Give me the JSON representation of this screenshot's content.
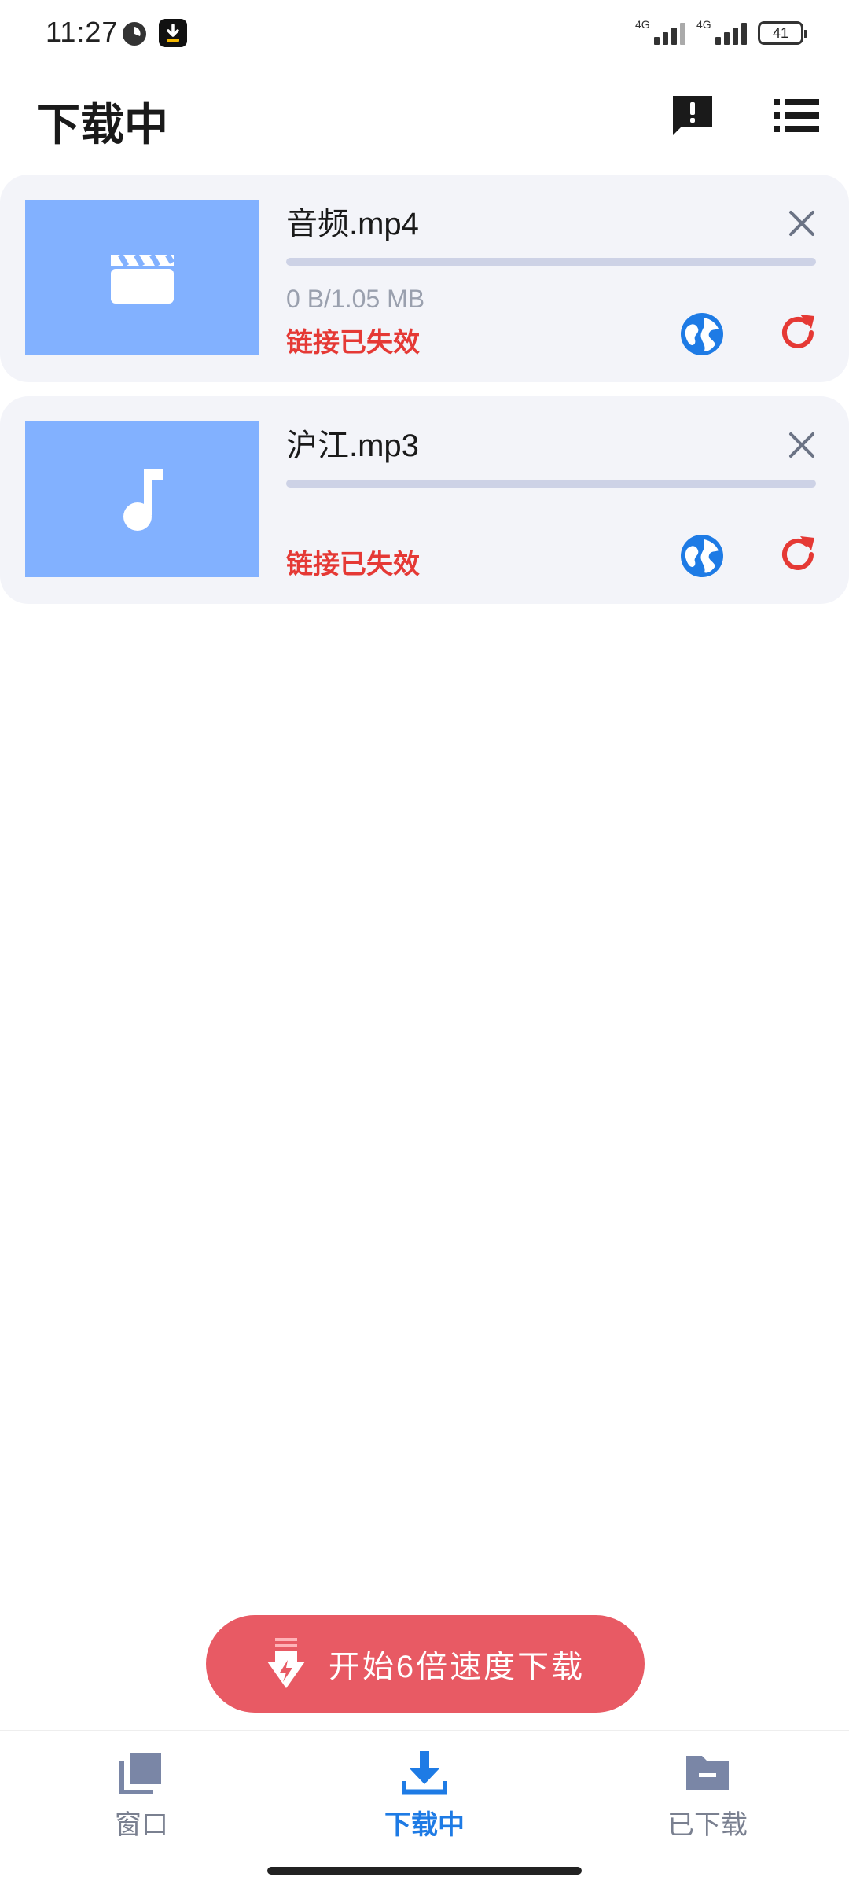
{
  "status_bar": {
    "time": "11:27",
    "signal_1_label": "4G",
    "signal_2_label": "4G",
    "battery": "41"
  },
  "header": {
    "title": "下载中",
    "feedback_icon": "feedback-icon",
    "menu_icon": "list-menu-icon"
  },
  "downloads": [
    {
      "name": "音频.mp4",
      "type_icon": "video-clapper-icon",
      "size": "0 B/1.05 MB",
      "status": "链接已失效",
      "progress": 0
    },
    {
      "name": "沪江.mp3",
      "type_icon": "music-note-icon",
      "size": "",
      "status": "链接已失效",
      "progress": 0
    }
  ],
  "speed_button": {
    "label": "开始6倍速度下载"
  },
  "bottom_nav": {
    "items": [
      {
        "label": "窗口",
        "icon": "windows-icon",
        "active": false
      },
      {
        "label": "下载中",
        "icon": "download-icon",
        "active": true
      },
      {
        "label": "已下载",
        "icon": "folder-icon",
        "active": false
      }
    ]
  },
  "colors": {
    "accent": "#1e7be5",
    "error": "#e53935",
    "thumb_bg": "#82b1ff",
    "speed_button": "#e85a64",
    "card_bg": "#f3f4f9"
  }
}
